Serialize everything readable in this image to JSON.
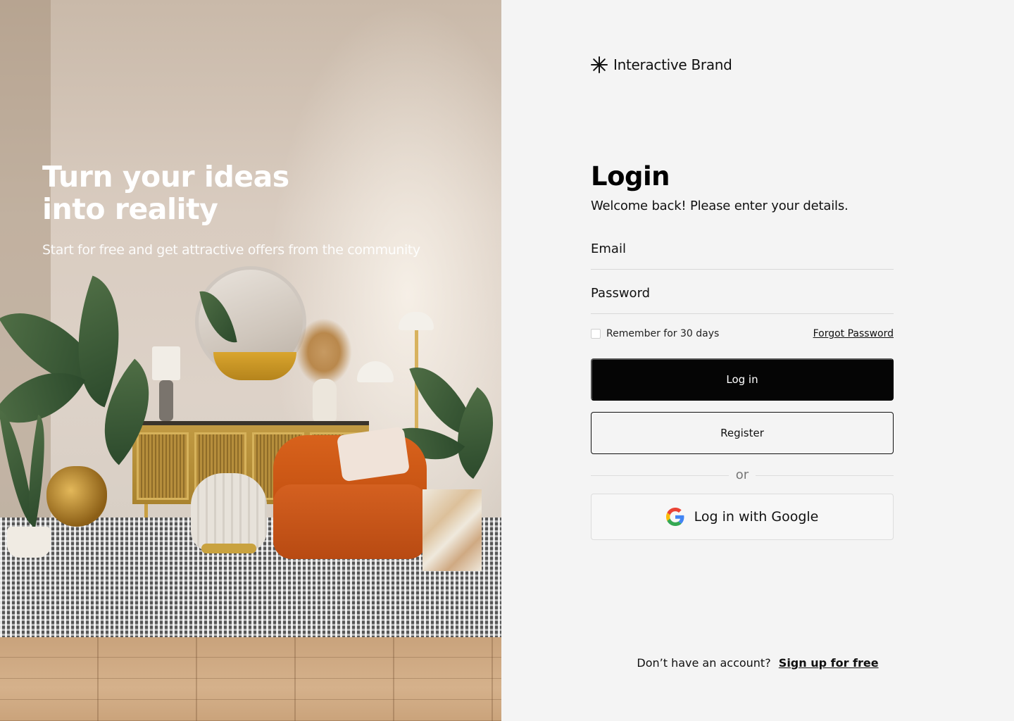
{
  "hero": {
    "title": "Turn your ideas\ninto reality",
    "subtitle": "Start for free and get attractive offers from the community"
  },
  "brand": {
    "icon": "asterisk-icon",
    "name": "Interactive Brand"
  },
  "login": {
    "title": "Login",
    "subtitle": "Welcome back! Please enter your details.",
    "email_placeholder": "Email",
    "password_placeholder": "Password",
    "remember_label": "Remember for 30 days",
    "remember_checked": false,
    "forgot_label": "Forgot Password",
    "login_button": "Log in",
    "register_button": "Register",
    "divider_text": "or",
    "google_button": "Log in with Google",
    "google_icon": "google-icon"
  },
  "footer": {
    "prompt": "Don’t have an account?",
    "signup_link": "Sign up for free"
  },
  "colors": {
    "primary_button": "#050505",
    "panel_background": "#f4f4f4",
    "text": "#111111"
  }
}
